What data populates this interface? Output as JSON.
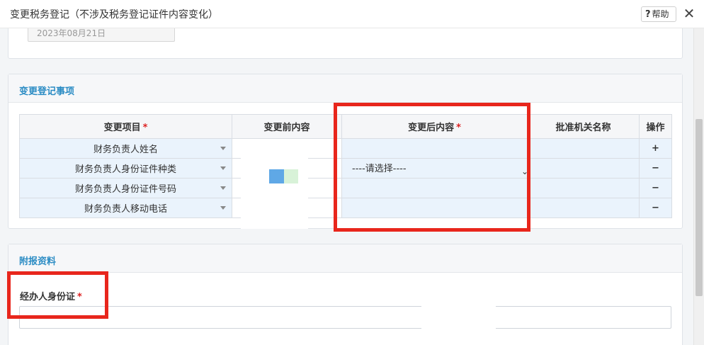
{
  "window": {
    "title": "变更税务登记（不涉及税务登记证件内容变化）",
    "help_label": "帮助",
    "help_q": "?",
    "close_glyph": "✕"
  },
  "top_panel": {
    "date_value": "2023年08月21日"
  },
  "change_section": {
    "title": "变更登记事项",
    "headers": {
      "item": "变更项目",
      "before": "变更前内容",
      "after": "变更后内容",
      "authority": "批准机关名称",
      "op": "操作"
    },
    "required_mark": "*",
    "rows": [
      {
        "item": "财务负责人姓名",
        "after": "",
        "op": "+"
      },
      {
        "item": "财务负责人身份证件种类",
        "after": "----请选择----",
        "op": "−"
      },
      {
        "item": "财务负责人身份证件号码",
        "after": "",
        "op": "−"
      },
      {
        "item": "财务负责人移动电话",
        "after": "",
        "op": "−"
      }
    ]
  },
  "attachments": {
    "title": "附报资料",
    "field_label": "经办人身份证",
    "required_mark": "*"
  },
  "colors": {
    "accent": "#2b8cc4",
    "highlight_box": "#e8261c",
    "row_bg": "#eaf3fc"
  }
}
